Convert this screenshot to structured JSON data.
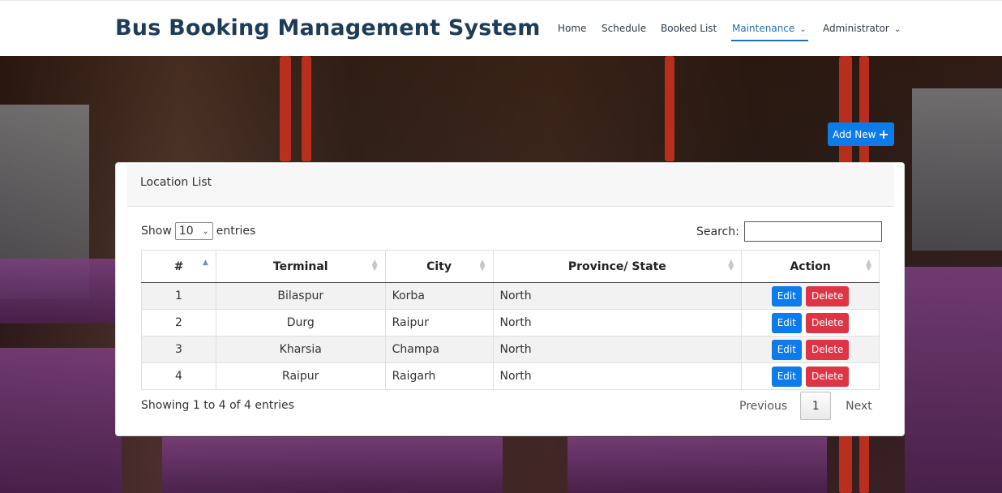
{
  "app": {
    "title": "Bus Booking Management System"
  },
  "nav": {
    "items": [
      {
        "label": "Home"
      },
      {
        "label": "Schedule"
      },
      {
        "label": "Booked List"
      },
      {
        "label": "Maintenance",
        "dropdown": true,
        "active": true
      },
      {
        "label": "Administrator",
        "dropdown": true
      }
    ]
  },
  "toolbar": {
    "add_new_label": "Add New",
    "add_icon": "plus-icon"
  },
  "card": {
    "title": "Location List"
  },
  "length": {
    "prefix": "Show",
    "value": "10",
    "suffix": "entries"
  },
  "search": {
    "label": "Search:",
    "value": ""
  },
  "table": {
    "columns": [
      "#",
      "Terminal",
      "City",
      "Province/ State",
      "Action"
    ],
    "rows": [
      {
        "num": "1",
        "terminal": "Bilaspur",
        "city": "Korba",
        "province": "North"
      },
      {
        "num": "2",
        "terminal": "Durg",
        "city": "Raipur",
        "province": "North"
      },
      {
        "num": "3",
        "terminal": "Kharsia",
        "city": "Champa",
        "province": "North"
      },
      {
        "num": "4",
        "terminal": "Raipur",
        "city": "Raigarh",
        "province": "North"
      }
    ],
    "edit_label": "Edit",
    "delete_label": "Delete"
  },
  "footer": {
    "info": "Showing 1 to 4 of 4 entries",
    "previous": "Previous",
    "page": "1",
    "next": "Next"
  },
  "colors": {
    "brand": "#1f3c57",
    "primary": "#0d7be8",
    "danger": "#dc3545",
    "active_nav": "#1f6fb6"
  }
}
